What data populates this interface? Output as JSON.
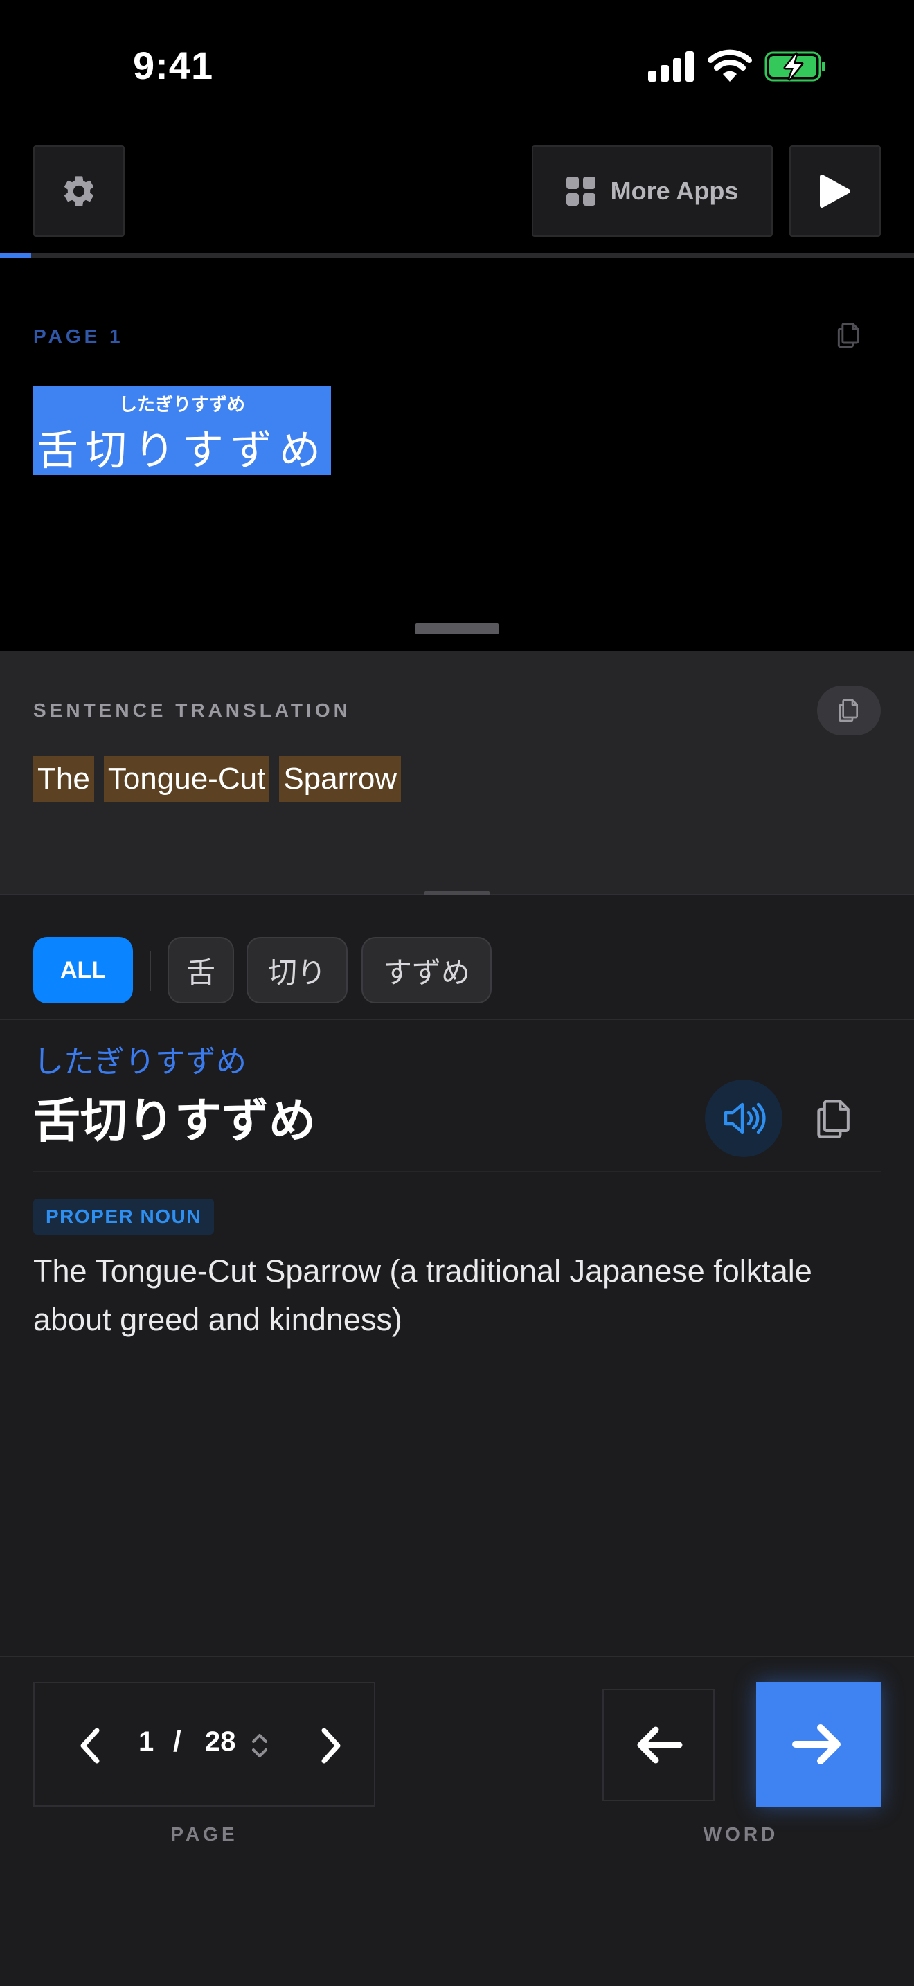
{
  "status_bar": {
    "time": "9:41"
  },
  "toolbar": {
    "more_apps_label": "More Apps",
    "progress_fraction": 0.034
  },
  "reader": {
    "page_label": "PAGE 1",
    "token": {
      "furigana": "したぎりすずめ",
      "text": "舌切りすずめ"
    }
  },
  "translation": {
    "heading": "SENTENCE TRANSLATION",
    "words": [
      "The",
      "Tongue-Cut",
      "Sparrow"
    ]
  },
  "filters": {
    "all_label": "ALL",
    "words": [
      "舌",
      "切り",
      "すずめ"
    ]
  },
  "entry": {
    "reading": "したぎりすずめ",
    "headword": "舌切りすずめ",
    "part_of_speech": "PROPER NOUN",
    "definition": "The Tongue-Cut Sparrow (a traditional Japanese folktale about greed and kindness)"
  },
  "pager": {
    "current": "1",
    "separator": "/",
    "total": "28",
    "caption": "PAGE"
  },
  "word_nav": {
    "caption": "WORD"
  },
  "colors": {
    "accent": "#3f82f2",
    "chip_active": "#0a84ff",
    "highlight": "#5c4122",
    "reading": "#3a7cf0"
  }
}
